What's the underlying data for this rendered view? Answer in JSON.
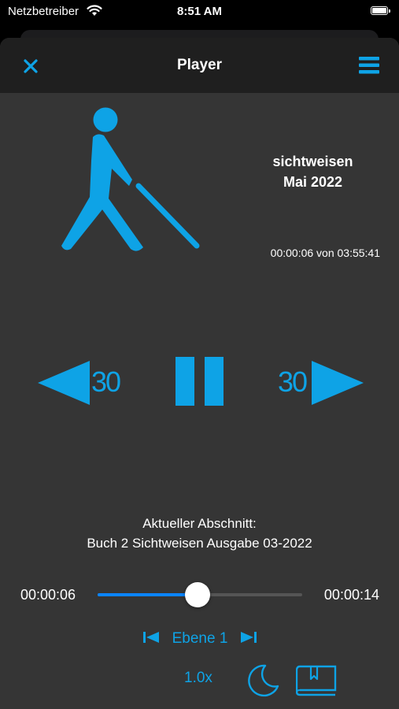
{
  "status_bar": {
    "carrier": "Netzbetreiber",
    "time": "8:51 AM"
  },
  "nav": {
    "title": "Player"
  },
  "book": {
    "title_line1": "sichtweisen",
    "title_line2": "Mai 2022"
  },
  "playback": {
    "position_text": "00:00:06 von 03:55:41",
    "skip_back_label": "30",
    "skip_forward_label": "30"
  },
  "section": {
    "caption": "Aktueller Abschnitt:",
    "name": "Buch 2 Sichtweisen Ausgabe 03-2022"
  },
  "progress": {
    "elapsed": "00:00:06",
    "remaining": "00:00:14",
    "fraction": 0.49
  },
  "level": {
    "label": "Ebene 1"
  },
  "controls": {
    "speed_label": "1.0x"
  },
  "colors": {
    "accent": "#0ea3e6",
    "sheet_bg": "#353535",
    "nav_bg": "#1f1f1f",
    "slider_fill": "#0a84ff"
  },
  "icons": [
    "wifi-icon",
    "battery-icon",
    "close-icon",
    "menu-icon",
    "blind-person-logo",
    "rewind-icon",
    "pause-icon",
    "forward-icon",
    "previous-level-icon",
    "next-level-icon",
    "moon-icon",
    "bookmark-book-icon"
  ]
}
